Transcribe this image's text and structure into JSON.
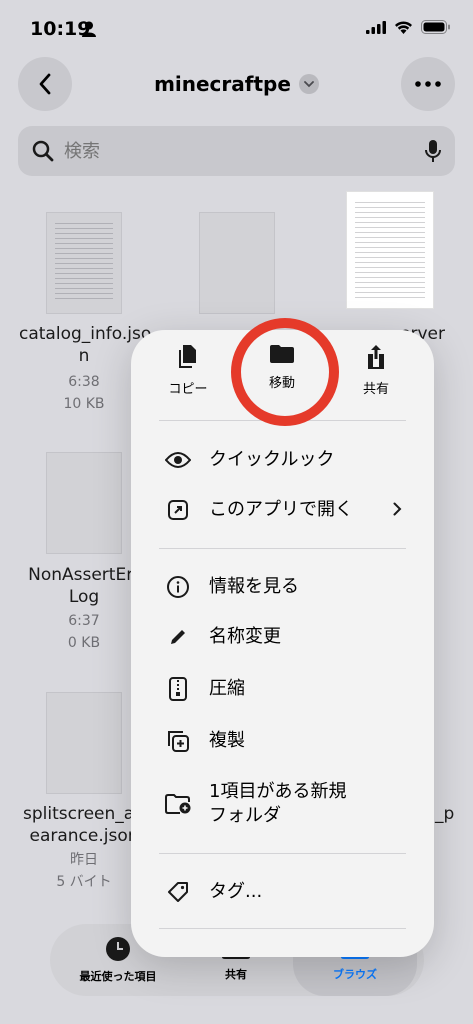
{
  "status_bar": {
    "time": "10:19"
  },
  "header": {
    "title": "minecraftpe"
  },
  "search": {
    "placeholder": "検索"
  },
  "files": [
    {
      "name_line1": "catalog_info.jso",
      "name_line2": "n",
      "time": "6:38",
      "size": "10 KB"
    },
    {
      "name_line1": "NonAssertErr",
      "name_line2": "Log",
      "time": "6:37",
      "size": "0 KB"
    },
    {
      "name_line1": "splitscreen_ap",
      "name_line2": "earance.json",
      "time": "昨日",
      "size": "5 バイト"
    }
  ],
  "partial_texts": {
    "right_col_top": "erver",
    "right_col_bottom": "_p"
  },
  "menu": {
    "actions": [
      {
        "label": "コピー",
        "icon": "copy-icon"
      },
      {
        "label": "移動",
        "icon": "folder-icon"
      },
      {
        "label": "共有",
        "icon": "share-icon"
      }
    ],
    "items": [
      {
        "label": "クイックルック",
        "icon": "eye-icon"
      },
      {
        "label": "このアプリで開く",
        "icon": "open-external-icon",
        "has_submenu": true
      },
      {
        "label": "情報を見る",
        "icon": "info-icon"
      },
      {
        "label": "名称変更",
        "icon": "pencil-icon"
      },
      {
        "label": "圧縮",
        "icon": "zip-icon"
      },
      {
        "label": "複製",
        "icon": "duplicate-icon"
      },
      {
        "label_line1": "1項目がある新規",
        "label_line2": "フォルダ",
        "icon": "new-folder-icon"
      },
      {
        "label": "タグ...",
        "icon": "tag-icon"
      }
    ]
  },
  "tabbar": {
    "tabs": [
      {
        "label": "最近使った項目",
        "icon": "clock-icon"
      },
      {
        "label": "共有",
        "icon": "shared-folder-icon"
      },
      {
        "label": "ブラウズ",
        "icon": "folder-icon",
        "active": true
      }
    ]
  },
  "colors": {
    "accent": "#0a7aff",
    "highlight": "#e53a2a"
  }
}
